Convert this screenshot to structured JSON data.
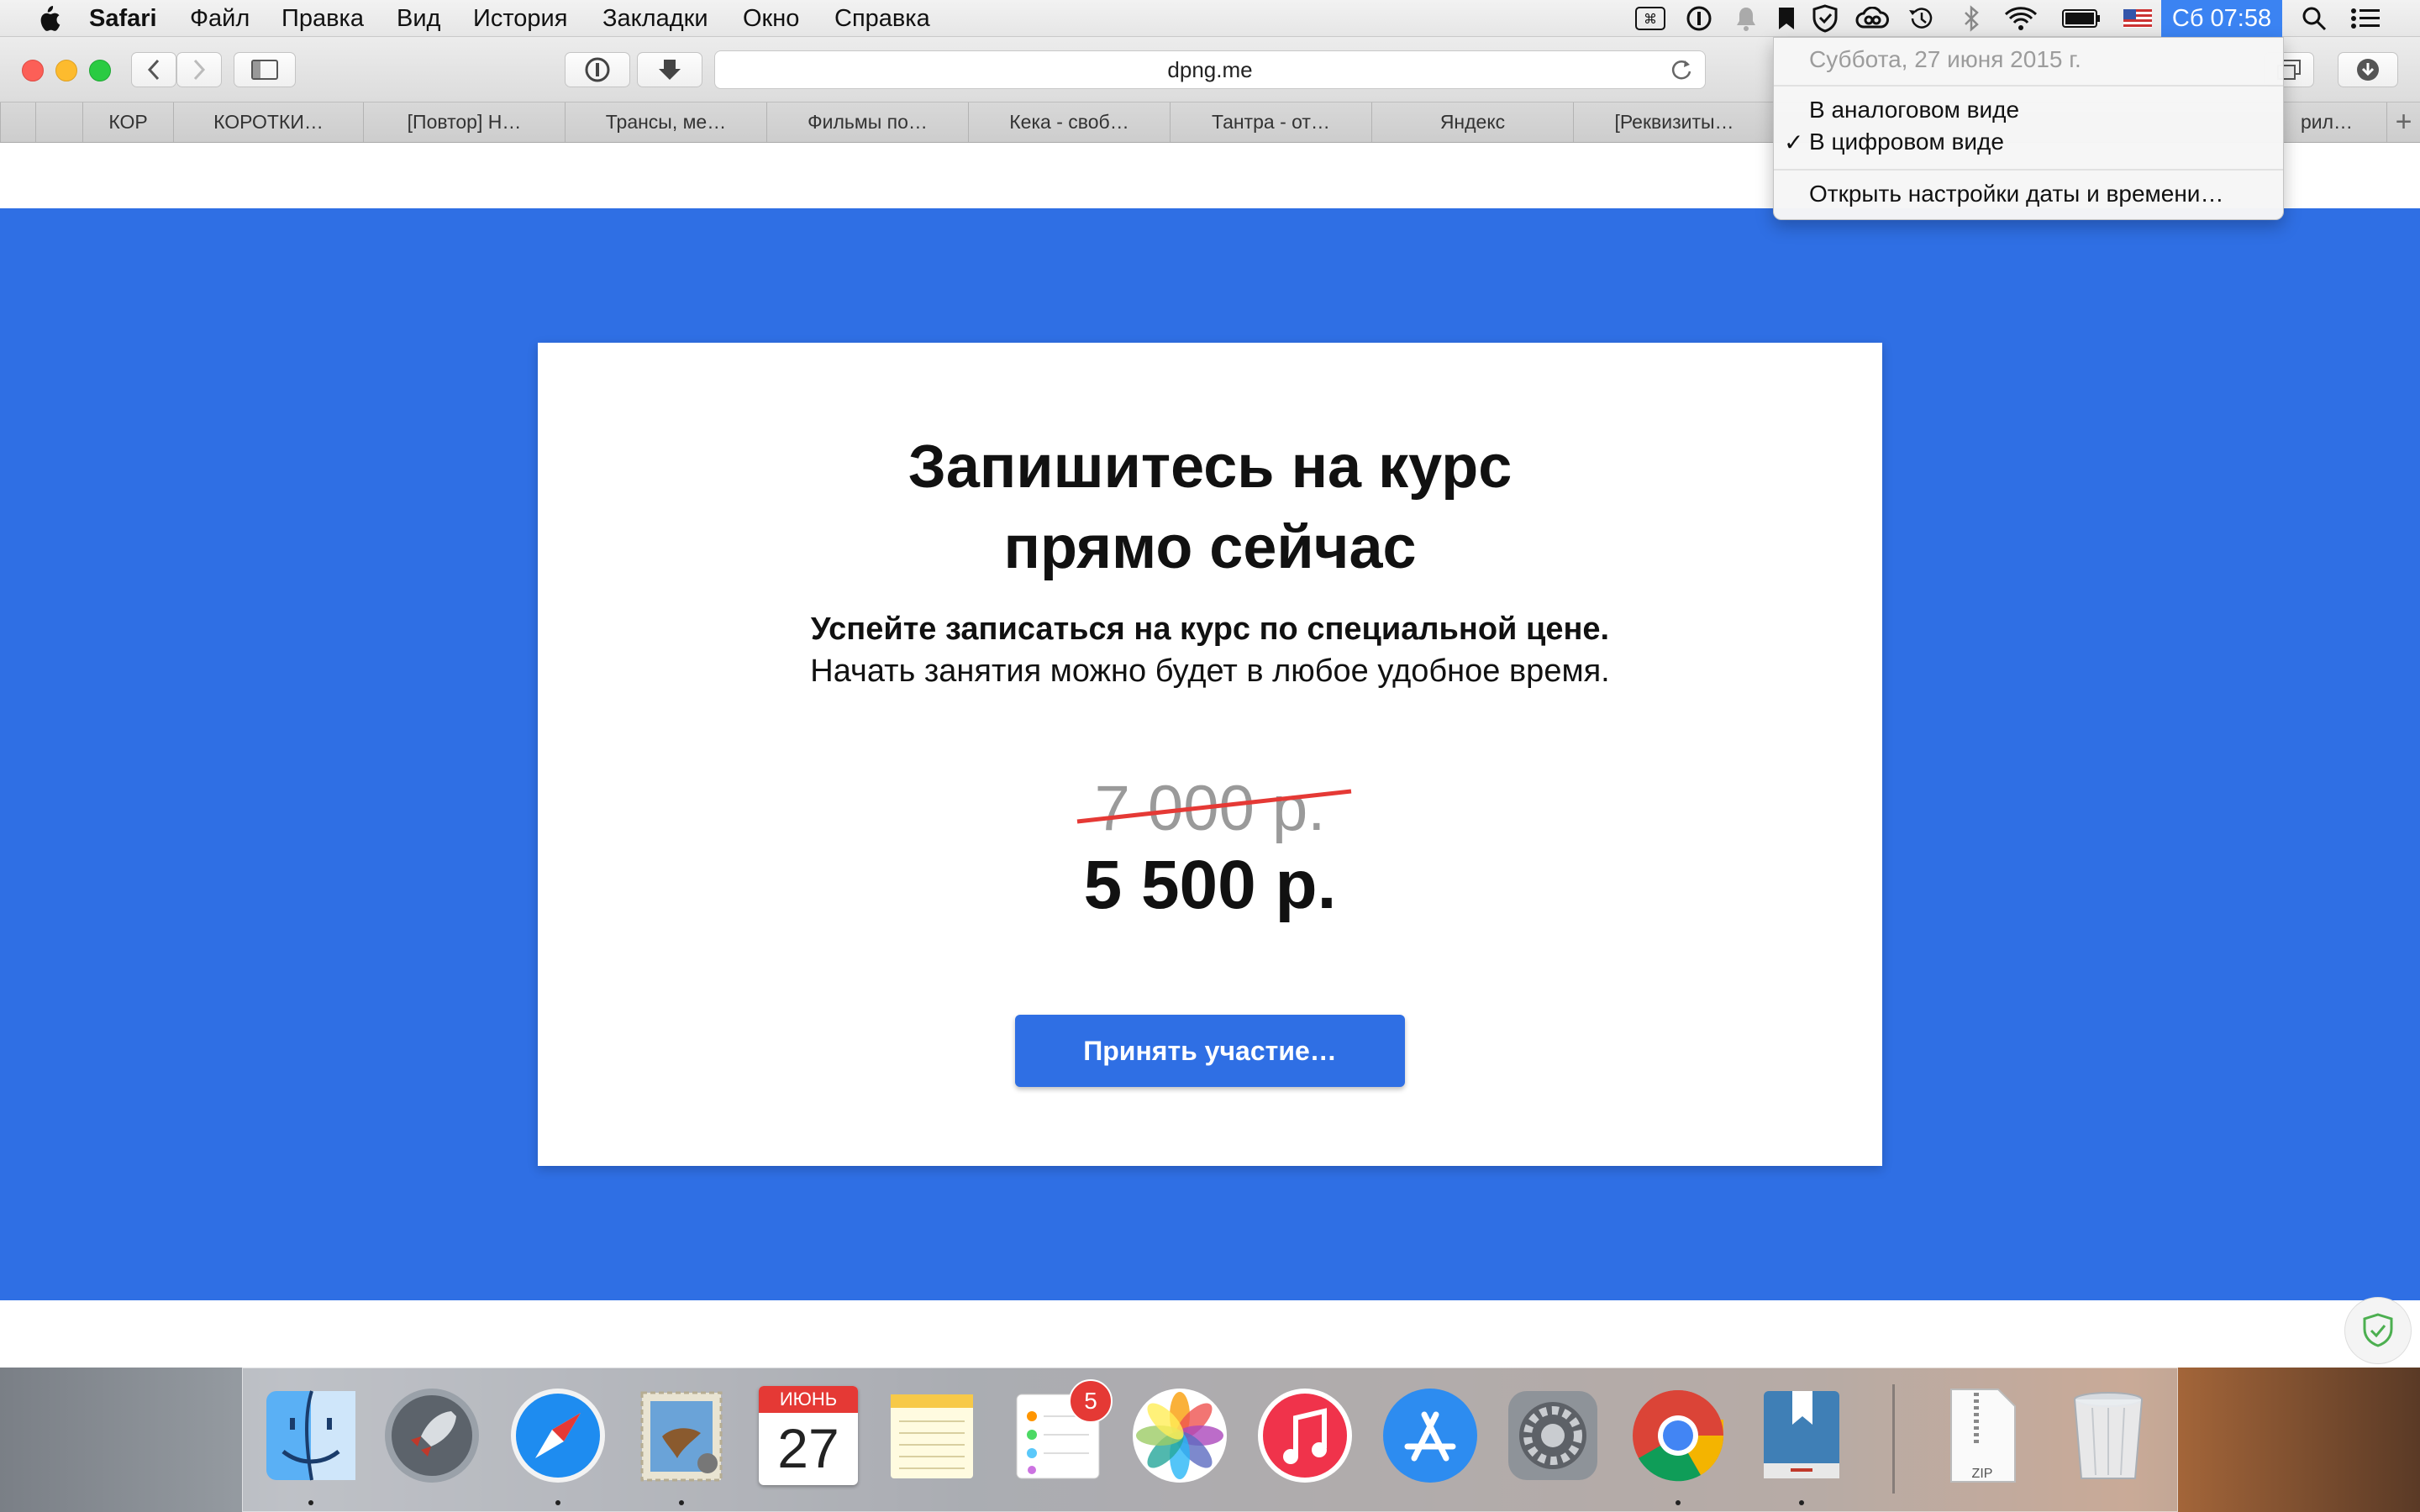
{
  "menubar": {
    "app_name": "Safari",
    "menus": [
      "Файл",
      "Правка",
      "Вид",
      "История",
      "Закладки",
      "Окно",
      "Справка"
    ],
    "tray_icons": [
      "keyboard-shortcut-icon",
      "onepassword-icon",
      "notification-bell-icon",
      "bookmark-icon",
      "shield-check-icon",
      "creative-cloud-icon",
      "time-machine-icon",
      "bluetooth-icon",
      "wifi-icon",
      "battery-icon",
      "us-flag-icon"
    ],
    "clock": "Сб 07:58",
    "search_icon": "spotlight-search-icon",
    "notification_center_icon": "list-icon"
  },
  "browser": {
    "address": "dpng.me",
    "tabs": [
      "КОР",
      "КОРОТКИ…",
      "[Повтор] Н…",
      "Трансы, ме…",
      "Фильмы по…",
      "Кека - своб…",
      "Тантра - от…",
      "Яндекс",
      "[Реквизиты…",
      "рил…"
    ],
    "new_tab_label": "+"
  },
  "clock_menu": {
    "date": "Суббота, 27 июня 2015 г.",
    "analog": "В аналоговом виде",
    "digital": "В цифровом виде",
    "checkmark": "✓",
    "open_settings": "Открыть настройки даты и времени…"
  },
  "page": {
    "title_line1": "Запишитесь на курс",
    "title_line2": "прямо сейчас",
    "subtitle_bold": "Успейте записаться на курс по специальной цене.",
    "subtitle": "Начать занятия можно будет в любое удобное время.",
    "old_price": "7 000 р.",
    "new_price": "5 500 р.",
    "cta": "Принять участие…",
    "accent_color": "#2f6fe4"
  },
  "dock": {
    "apps": [
      "finder",
      "launchpad",
      "safari",
      "mail",
      "calendar",
      "notes",
      "reminders",
      "photos",
      "itunes",
      "app-store",
      "system-preferences",
      "chrome",
      "dictionary",
      "zip-archive",
      "trash"
    ],
    "calendar_month": "ИЮНЬ",
    "calendar_day": "27",
    "reminders_badge": "5",
    "zip_label": "ZIP"
  }
}
